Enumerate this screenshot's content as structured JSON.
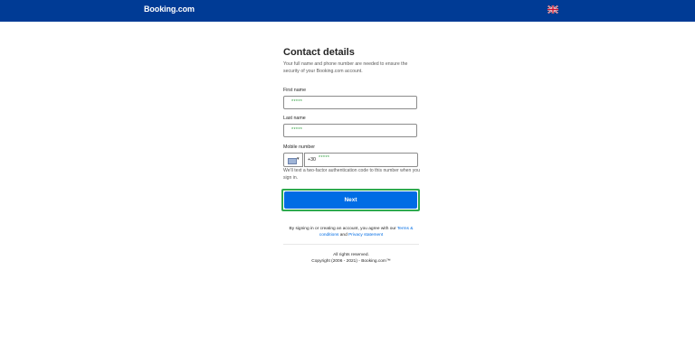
{
  "header": {
    "logo": "Booking.com",
    "language_icon": "uk-flag-icon"
  },
  "form": {
    "title": "Contact details",
    "subtitle": "Your full name and phone number are needed to ensure the security of your Booking.com account.",
    "first_name": {
      "label": "First name",
      "value": "*****"
    },
    "last_name": {
      "label": "Last name",
      "value": "*****"
    },
    "mobile": {
      "label": "Mobile number",
      "country_code": "+30",
      "value": "*****"
    },
    "hint": "We'll text a two-factor authentication code to this number when you sign in.",
    "next_label": "Next"
  },
  "legal": {
    "prefix": "By signing in or creating an account, you agree with our ",
    "terms_link": "Terms & conditions",
    "and": " and ",
    "privacy_link": "Privacy statement"
  },
  "footer": {
    "rights": "All rights reserved.",
    "copyright": "Copyright (2006 - 2021) - Booking.com™"
  },
  "colors": {
    "brand": "#003b95",
    "button": "#006ce4",
    "highlight": "#2eaa4e",
    "masked_text": "#2e9e3e"
  }
}
